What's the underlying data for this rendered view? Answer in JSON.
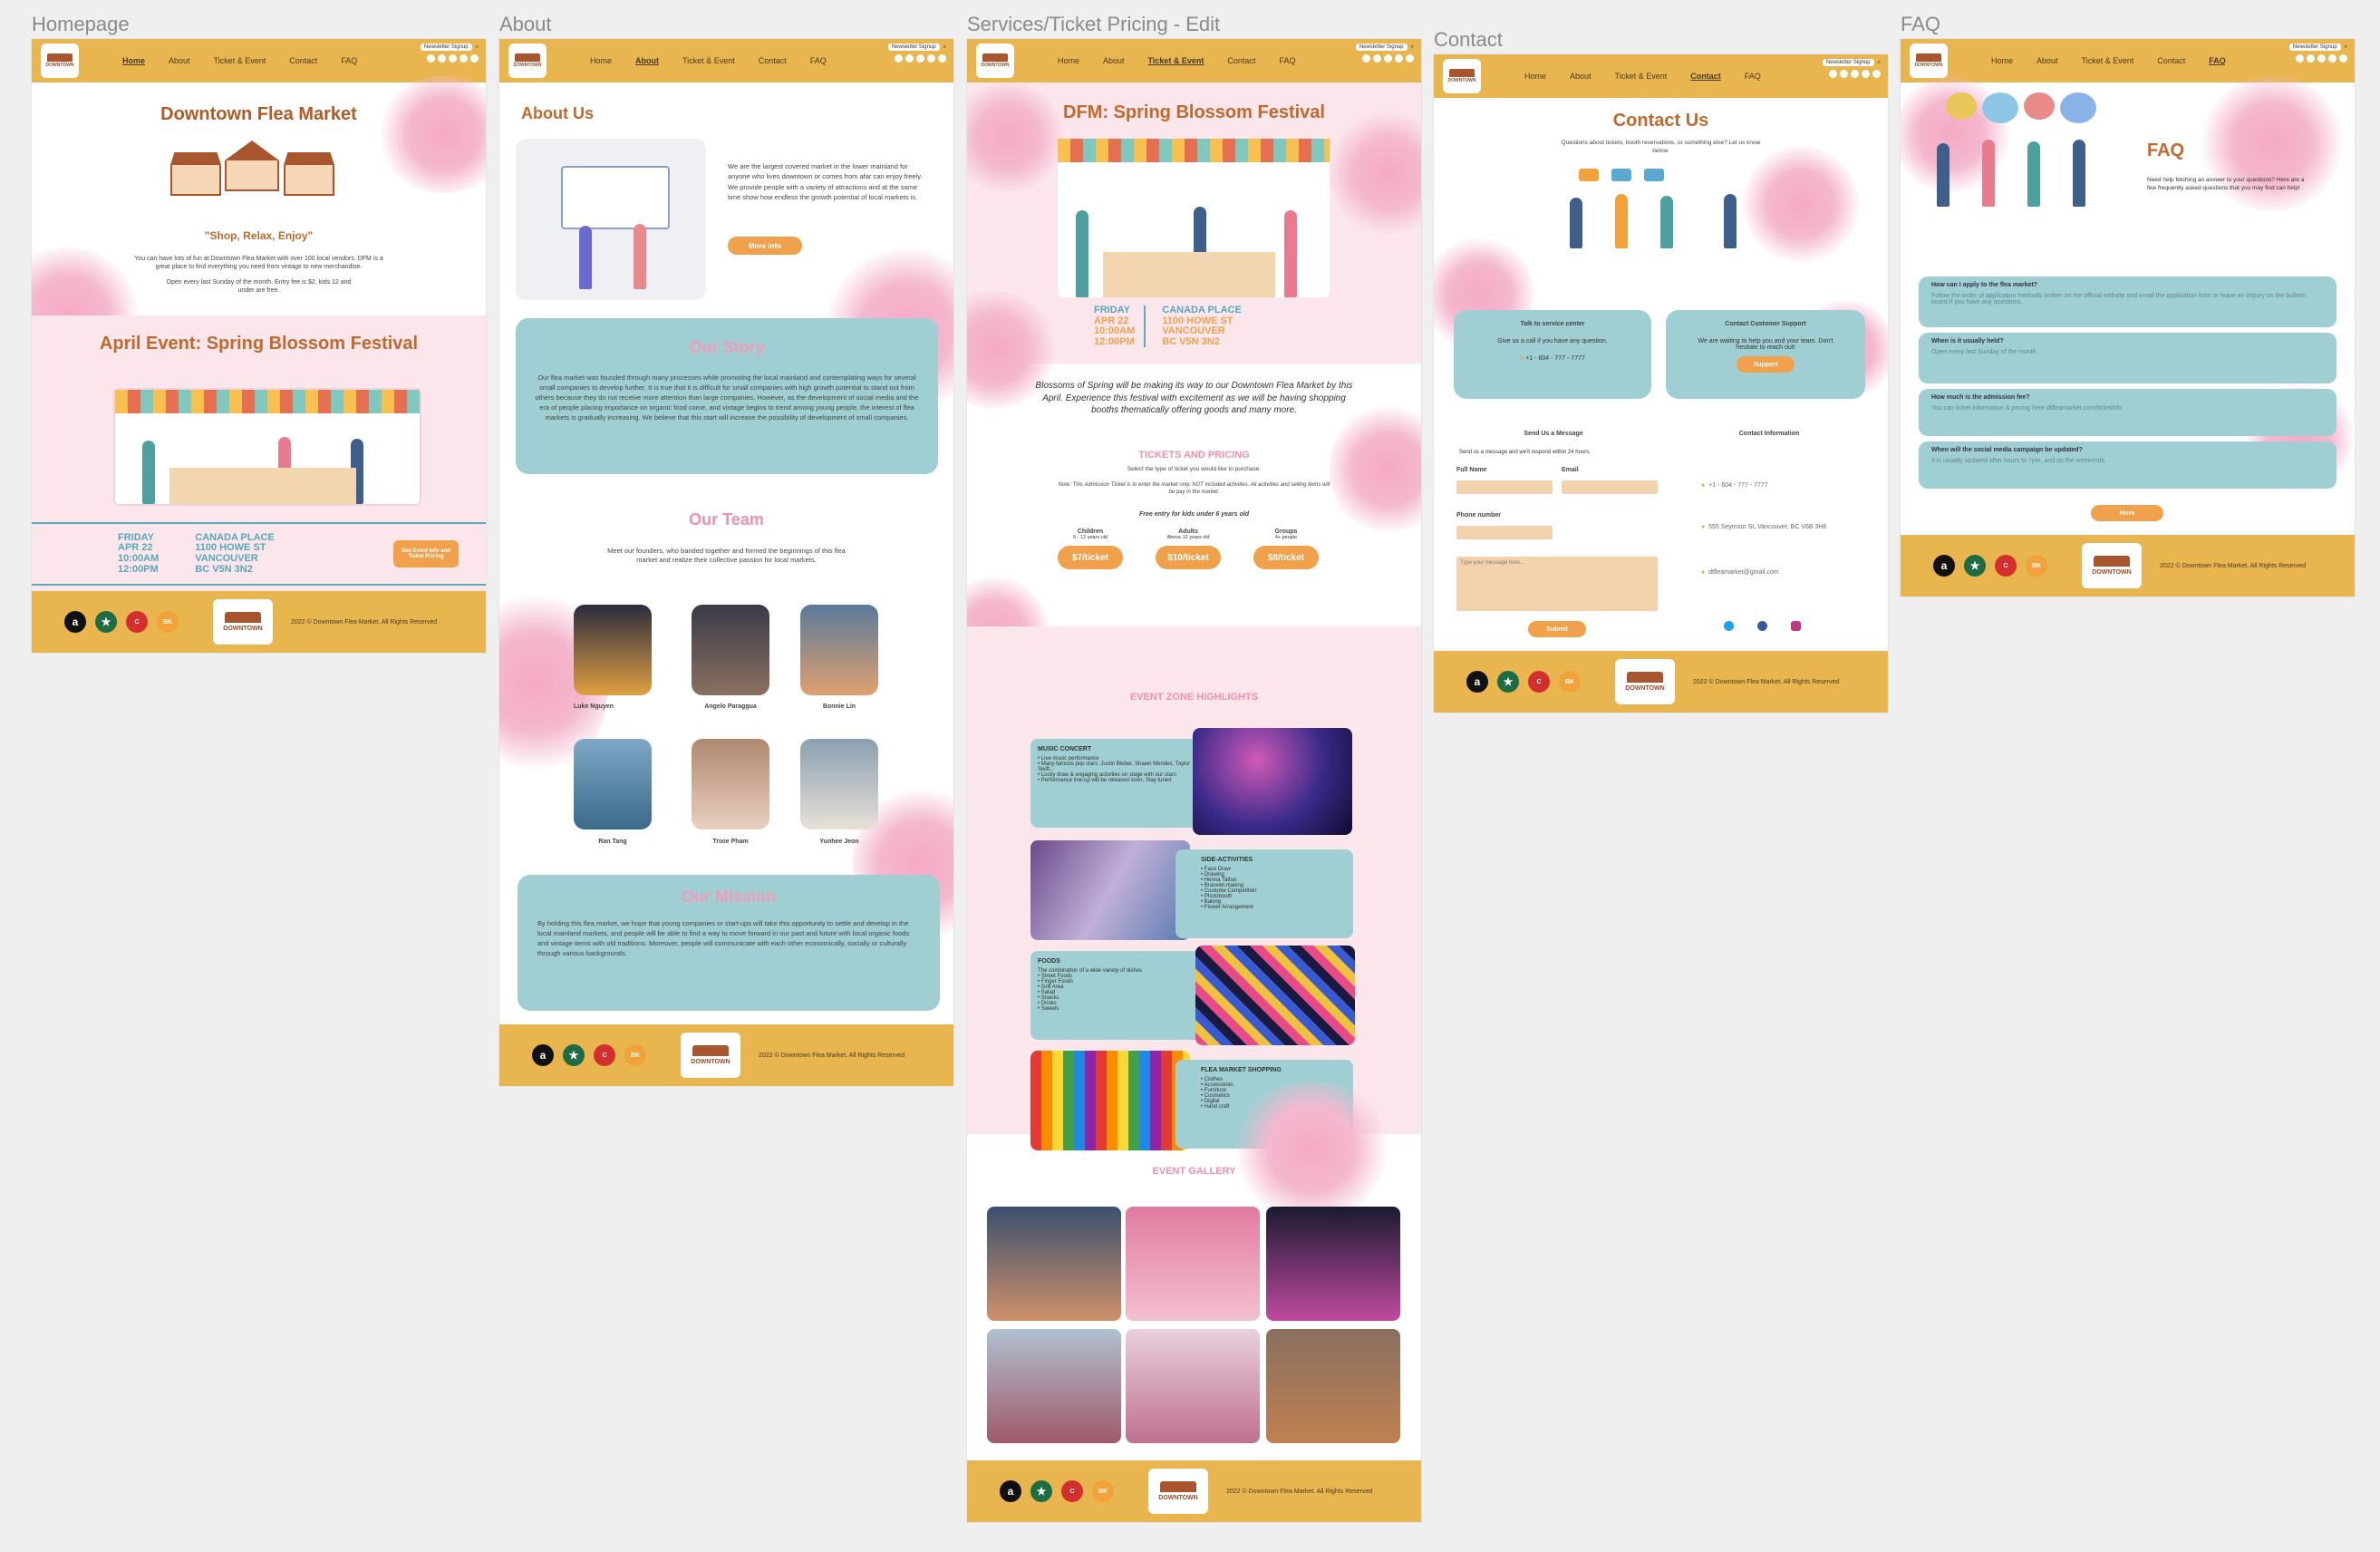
{
  "frames": {
    "homepage": "Homepage",
    "about": "About",
    "services": "Services/Ticket Pricing - Edit",
    "contact": "Contact",
    "faq": "FAQ"
  },
  "nav": {
    "home": "Home",
    "about": "About",
    "ticket": "Ticket & Event",
    "contact": "Contact",
    "faq": "FAQ",
    "newsletter": "Newsletter Signup"
  },
  "logo": {
    "line1": "DOWNTOWN",
    "line2": "Flea market"
  },
  "footer": {
    "copyright": "2022 © Downtown Flea Market. All Rights Reserved"
  },
  "home": {
    "title": "Downtown Flea Market",
    "tagline": "\"Shop, Relax, Enjoy\"",
    "intro": "You can have lots of fun at Downtown Flea Market with over 100 local vendors. DFM is a great place to find everything you need from vintage to new merchandise.",
    "hours": "Open every last Sunday of the month. Entry fee is $2, kids 12 and under are free.",
    "event_title": "April Event: Spring Blossom Festival",
    "date": [
      "FRIDAY",
      "APR 22",
      "10:00AM",
      "12:00PM"
    ],
    "place": [
      "CANADA PLACE",
      "1100 HOWE ST",
      "VANCOUVER",
      "BC V5N 3N2"
    ],
    "event_button": "See Event Info and Ticket Pricing"
  },
  "about": {
    "title": "About Us",
    "intro": "We are the largest covered market in the lower mainland for anyone who lives downtown or comes from afar can enjoy freely. We provide people with a variety of attractions and at the same time show how endless the growth potential of local markets is.",
    "more": "More info",
    "story_title": "Our Story",
    "story": "Our flea market was founded through many processes while promoting the local mainland and contemplating ways for several small companies to develop further. It is true that it is difficult for small companies with high growth potential to stand out from others because they do not receive more attention than large companies. However, as the development of social media and the era of people placing importance on organic food come, and vintage begins to trend among young people, the interest of flea markets is gradually increasing. We believe that this start will increase the possibility of development of small companies.",
    "team_title": "Our Team",
    "team_intro": "Meet our founders, who banded together and formed the beginnings of this flea market and realize their collective passion for local markets.",
    "team": [
      "Luke Nguyen",
      "Angelo Paraggua",
      "Bonnie Lin",
      "Ran Tang",
      "Trixie Pham",
      "Yunhee Jeon"
    ],
    "mission_title": "Our Mission",
    "mission": "By holding this flea market, we hope that young companies or start-ups will take this opportunity to settle and develop in the local mainland markets, and people will be able to find a way to move forward in our past and future with local organic foods and vintage items with old traditions. Moreover, people will communicate with each other economically, socially or culturally through various backgrounds."
  },
  "services": {
    "title": "DFM: Spring Blossom Festival",
    "date": [
      "FRIDAY",
      "APR 22",
      "10:00AM",
      "12:00PM"
    ],
    "place": [
      "CANADA PLACE",
      "1100 HOWE ST",
      "VANCOUVER",
      "BC V5N 3N2"
    ],
    "blurb": "Blossoms of Spring will be making its way to our Downtown Flea Market by this April. Experience this festival with excitement as we will be having shopping booths thematically offering goods and many more.",
    "tickets_title": "TICKETS AND PRICING",
    "tickets_sub": "Select the type of ticket you would like to purchase.",
    "tickets_note": "Note: This Admission Ticket is to enter the market only. NOT included activities. All activities and selling items will be pay in the market.",
    "free": "Free entry for kids under 6 years old",
    "prices": [
      {
        "label": "Children",
        "sub": "6 - 12 years old",
        "price": "$7/ticket"
      },
      {
        "label": "Adults",
        "sub": "Above 12 years old",
        "price": "$10/ticket"
      },
      {
        "label": "Groups",
        "sub": "4+ people",
        "price": "$8/ticket"
      }
    ],
    "zones_title": "EVENT ZONE HIGHLIGHTS",
    "zones": [
      {
        "title": "MUSIC CONCERT",
        "items": [
          "Live music performance",
          "Many famous pop stars: Justin Bieber, Shawn Mendes, Taylor Swift...",
          "Lucky draw & engaging activities on stage with our stars",
          "Performance line-up will be released soon. Stay tuned"
        ]
      },
      {
        "title": "SIDE-ACTIVITIES",
        "items": [
          "Face Draw",
          "Drawing",
          "Henna Tattoo",
          "Bracelet-making",
          "Costume Competition",
          "Photobooth",
          "Baking",
          "Flower Arrangement"
        ]
      },
      {
        "title": "FOODS",
        "items": [
          "The combination of a wide variety of dishes",
          "Street Foods",
          "Finger Foods",
          "Grill Area",
          "Salad",
          "Snacks",
          "Drinks",
          "Sweets"
        ]
      },
      {
        "title": "FLEA MARKET SHOPPING",
        "items": [
          "Clothes",
          "Accessories",
          "Furniture",
          "Cosmetics",
          "Digital",
          "Hand craft"
        ]
      }
    ],
    "gallery_title": "EVENT GALLERY"
  },
  "contact": {
    "title": "Contact Us",
    "sub": "Questions about tickets, booth reservations, or something else? Let us know below.",
    "service_title": "Talk to service center",
    "service_text": "Give us a call if you have any question.",
    "phone": "+1 - 604 - 777 - 7777",
    "support_title": "Contact Customer Support",
    "support_text": "We are waiting to help you and your team. Don't hesitate to reach out!",
    "support_btn": "Support",
    "msg_title": "Send Us a Message",
    "msg_sub": "Send us a message and we'll respond within 24 hours.",
    "full_name": "Full Name",
    "email": "Email",
    "phone_label": "Phone number",
    "placeholder": "Type your message here...",
    "submit": "Submit",
    "info_title": "Contact Information",
    "info_phone": "+1 - 604 - 777 - 7777",
    "address": "555 Seymour St, Vancouver, BC V6B 3H6",
    "email_addr": "dtfleamarket@gmail.com"
  },
  "faq": {
    "title": "FAQ",
    "sub": "Need help fetching an answer to your questions? Here are a few frequently asked questions that you may find can help!",
    "items": [
      {
        "q": "How can I apply to the flea market?",
        "a": "Follow the order of application methods written on the official website and email the application form or leave an inquiry on the bulletin board if you have any questions."
      },
      {
        "q": "When is it usually held?",
        "a": "Open every last Sunday of the month."
      },
      {
        "q": "How much is the admission fee?",
        "a": "You can ticket information & pricing here dtfleamarket.com/ticketinfo"
      },
      {
        "q": "When will the social media campaign be updated?",
        "a": "It is usually updated after hours to 7pm, and on the weekends."
      }
    ],
    "more": "More"
  },
  "colors": {
    "nav": "#e8b54f",
    "title": "#b05a25",
    "teal": "#9fcfd3",
    "pink": "#f49abb",
    "button": "#f1a14b"
  }
}
